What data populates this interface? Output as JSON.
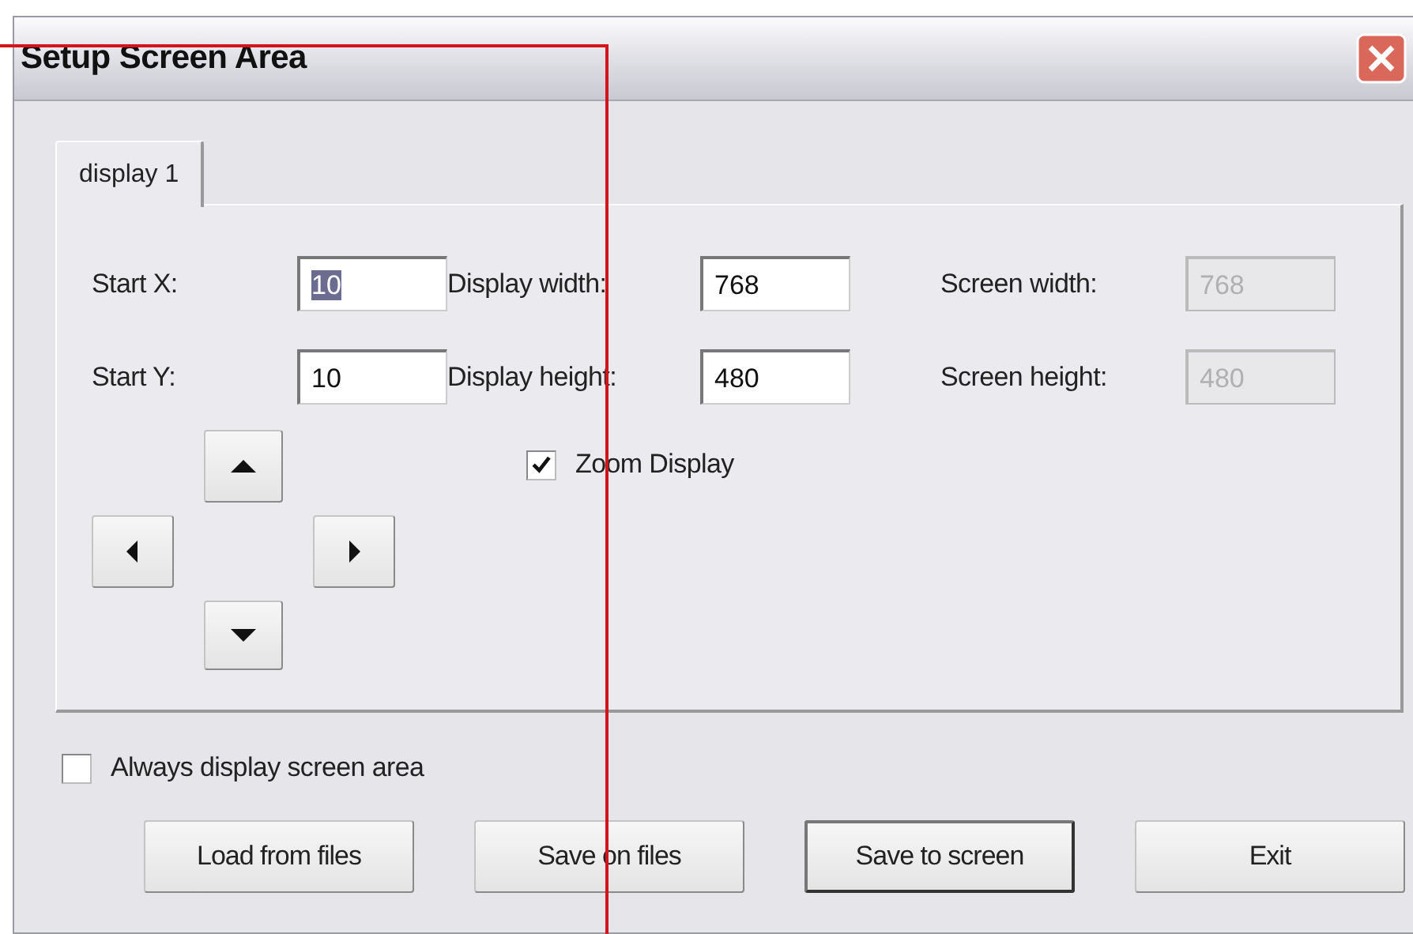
{
  "window": {
    "title": "Setup Screen Area"
  },
  "tabs": [
    {
      "label": "display 1",
      "selected": true
    }
  ],
  "field_rows": [
    {
      "fields": [
        {
          "label": "Start X:",
          "value": "10",
          "disabled": false,
          "highlighted": true
        },
        {
          "label": "Display width:",
          "value": "768",
          "disabled": false,
          "highlighted": false
        },
        {
          "label": "Screen width:",
          "value": "768",
          "disabled": true,
          "highlighted": false
        }
      ]
    },
    {
      "fields": [
        {
          "label": "Start Y:",
          "value": "10",
          "disabled": false,
          "highlighted": false
        },
        {
          "label": "Display height:",
          "value": "480",
          "disabled": false,
          "highlighted": false
        },
        {
          "label": "Screen height:",
          "value": "480",
          "disabled": true,
          "highlighted": false
        }
      ]
    }
  ],
  "arrow_buttons": [
    {
      "kind": "up"
    },
    {
      "kind": "left"
    },
    {
      "kind": "right"
    },
    {
      "kind": "down"
    }
  ],
  "zoom_display": {
    "label": "Zoom Display",
    "checked": true
  },
  "always_display": {
    "label": "Always display screen area",
    "checked": false
  },
  "buttons": [
    {
      "label": "Load from files",
      "default": false
    },
    {
      "label": "Save on files",
      "default": false
    },
    {
      "label": "Save to screen",
      "default": true
    },
    {
      "label": "Exit",
      "default": false
    }
  ]
}
